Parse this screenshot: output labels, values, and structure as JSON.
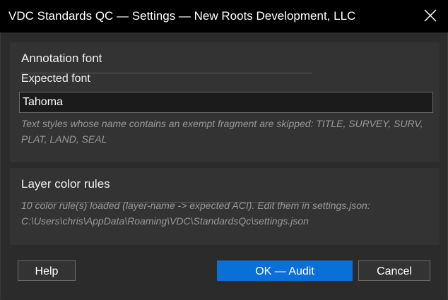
{
  "window": {
    "title": "VDC Standards QC — Settings — New Roots Development, LLC",
    "close_icon": "close-icon"
  },
  "annotation": {
    "section_title": "Annotation font",
    "expected_label": "Expected font",
    "font_value": "Tahoma",
    "hint": "Text styles whose name contains an exempt fragment are skipped: TITLE, SURVEY, SURV, PLAT, LAND, SEAL"
  },
  "layer_colors": {
    "section_title": "Layer color rules",
    "hint": "10 color rule(s) loaded (layer-name -> expected ACI). Edit them in settings.json: C:\\Users\\chris\\AppData\\Roaming\\VDC\\StandardsQc\\settings.json"
  },
  "buttons": {
    "help": "Help",
    "ok": "OK — Audit",
    "cancel": "Cancel"
  },
  "colors": {
    "accent": "#0a6fd6",
    "titlebar": "#000000",
    "background": "#2b2b2b"
  }
}
